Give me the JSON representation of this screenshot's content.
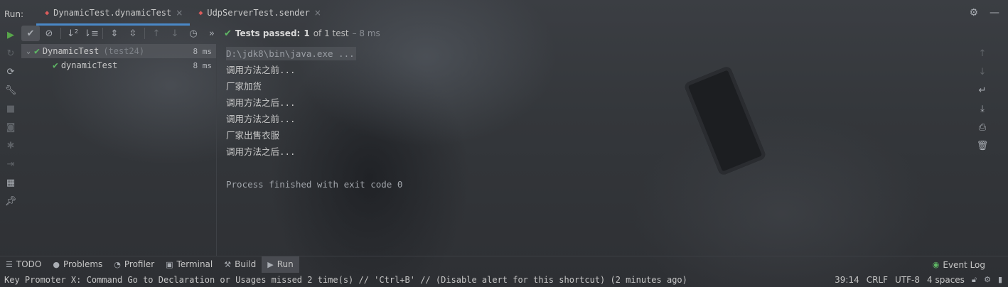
{
  "header": {
    "run_label": "Run:",
    "tabs": [
      {
        "label": "DynamicTest.dynamicTest",
        "active": true
      },
      {
        "label": "UdpServerTest.sender",
        "active": false
      }
    ],
    "close_glyph": "×"
  },
  "toolbar": {
    "status": {
      "prefix": "Tests passed:",
      "count": "1",
      "of_text": "of 1 test",
      "duration": "– 8 ms"
    }
  },
  "tree": {
    "items": [
      {
        "name": "DynamicTest",
        "detail": "(test24)",
        "time": "8 ms",
        "expanded": true,
        "selected": true
      },
      {
        "name": "dynamicTest",
        "detail": "",
        "time": "8 ms",
        "expanded": false,
        "selected": false
      }
    ]
  },
  "console": {
    "command": "D:\\jdk8\\bin\\java.exe ...",
    "lines": [
      "调用方法之前...",
      "厂家加货",
      "调用方法之后...",
      "调用方法之前...",
      "厂家出售衣服",
      "调用方法之后..."
    ],
    "finish": "Process finished with exit code 0"
  },
  "tool_windows": {
    "items": [
      {
        "label": "TODO",
        "icon": "list-icon",
        "active": false
      },
      {
        "label": "Problems",
        "icon": "info-icon",
        "active": false
      },
      {
        "label": "Profiler",
        "icon": "profiler-icon",
        "active": false
      },
      {
        "label": "Terminal",
        "icon": "terminal-icon",
        "active": false
      },
      {
        "label": "Build",
        "icon": "hammer-icon",
        "active": false
      },
      {
        "label": "Run",
        "icon": "play-icon",
        "active": true
      }
    ],
    "event_log": "Event Log"
  },
  "status_bar": {
    "message": "Key Promoter X: Command Go to Declaration or Usages missed 2 time(s) // 'Ctrl+B' // (Disable alert for this shortcut) (2 minutes ago)",
    "position": "39:14",
    "line_ending": "CRLF",
    "encoding": "UTF-8",
    "indent": "4 spaces"
  },
  "colors": {
    "accent": "#4a88c7",
    "success": "#5fb865",
    "text": "#c9c9c9"
  }
}
